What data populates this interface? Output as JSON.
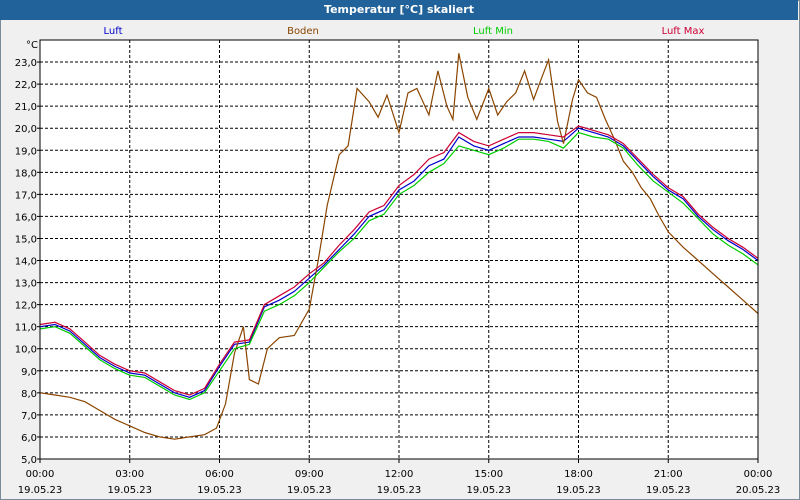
{
  "window": {
    "title": "Temperatur [°C] skaliert"
  },
  "chart_data": {
    "type": "line",
    "title": "Temperatur [°C] skaliert",
    "ylabel": "°C",
    "ylim": [
      5.0,
      24.0
    ],
    "xlim": [
      0,
      24
    ],
    "grid": true,
    "y_ticks": [
      "5,0",
      "6,0",
      "7,0",
      "8,0",
      "9,0",
      "10,0",
      "11,0",
      "12,0",
      "13,0",
      "14,0",
      "15,0",
      "16,0",
      "17,0",
      "18,0",
      "19,0",
      "20,0",
      "21,0",
      "22,0",
      "23,0"
    ],
    "x_ticks": [
      {
        "time": "00:00",
        "date": "19.05.23"
      },
      {
        "time": "03:00",
        "date": "19.05.23"
      },
      {
        "time": "06:00",
        "date": "19.05.23"
      },
      {
        "time": "09:00",
        "date": "19.05.23"
      },
      {
        "time": "12:00",
        "date": "19.05.23"
      },
      {
        "time": "15:00",
        "date": "19.05.23"
      },
      {
        "time": "18:00",
        "date": "19.05.23"
      },
      {
        "time": "21:00",
        "date": "19.05.23"
      },
      {
        "time": "00:00",
        "date": "20.05.23"
      }
    ],
    "series": [
      {
        "name": "Luft",
        "color": "#0000cc",
        "x": [
          0,
          0.5,
          1,
          1.5,
          2,
          2.5,
          3,
          3.5,
          4,
          4.5,
          5,
          5.5,
          6,
          6.5,
          7,
          7.5,
          8,
          8.5,
          9,
          9.5,
          10,
          10.5,
          11,
          11.5,
          12,
          12.5,
          13,
          13.5,
          14,
          14.5,
          15,
          15.5,
          16,
          16.5,
          17,
          17.5,
          18,
          18.5,
          19,
          19.5,
          20,
          20.5,
          21,
          21.5,
          22,
          22.5,
          23,
          23.5,
          24
        ],
        "values": [
          11.0,
          11.1,
          10.8,
          10.2,
          9.6,
          9.2,
          8.9,
          8.8,
          8.4,
          8.0,
          7.8,
          8.1,
          9.2,
          10.2,
          10.3,
          11.9,
          12.2,
          12.6,
          13.2,
          13.8,
          14.5,
          15.2,
          16.0,
          16.3,
          17.2,
          17.6,
          18.3,
          18.6,
          19.6,
          19.2,
          19.0,
          19.3,
          19.6,
          19.6,
          19.5,
          19.4,
          20.0,
          19.8,
          19.6,
          19.2,
          18.5,
          17.8,
          17.2,
          16.8,
          16.0,
          15.4,
          14.9,
          14.5,
          14.0
        ]
      },
      {
        "name": "Boden",
        "color": "#8b4500",
        "x": [
          0,
          0.5,
          1,
          1.5,
          2,
          2.5,
          3,
          3.5,
          4,
          4.5,
          5,
          5.5,
          5.9,
          6.2,
          6.5,
          6.8,
          7,
          7.3,
          7.6,
          8,
          8.5,
          9,
          9.3,
          9.6,
          10,
          10.3,
          10.6,
          11,
          11.3,
          11.6,
          12,
          12.3,
          12.6,
          13,
          13.3,
          13.6,
          13.8,
          14,
          14.3,
          14.6,
          15,
          15.3,
          15.6,
          15.9,
          16.2,
          16.5,
          16.8,
          17,
          17.3,
          17.5,
          17.8,
          18,
          18.3,
          18.6,
          18.9,
          19.2,
          19.5,
          19.8,
          20.1,
          20.4,
          20.7,
          21,
          21.5,
          22,
          22.5,
          23,
          23.5,
          24
        ],
        "values": [
          8.0,
          7.9,
          7.8,
          7.6,
          7.2,
          6.8,
          6.5,
          6.2,
          6.0,
          5.9,
          6.0,
          6.1,
          6.4,
          7.5,
          9.8,
          11.0,
          8.6,
          8.4,
          10.0,
          10.5,
          10.6,
          11.8,
          14.0,
          16.5,
          18.8,
          19.2,
          21.8,
          21.2,
          20.5,
          21.5,
          19.8,
          21.6,
          21.8,
          20.6,
          22.6,
          21.0,
          20.4,
          23.4,
          21.4,
          20.4,
          21.8,
          20.6,
          21.2,
          21.6,
          22.6,
          21.3,
          22.4,
          23.1,
          20.3,
          19.3,
          21.3,
          22.2,
          21.6,
          21.4,
          20.4,
          19.5,
          18.5,
          18.0,
          17.3,
          16.8,
          16.0,
          15.3,
          14.6,
          14.0,
          13.4,
          12.8,
          12.2,
          11.6
        ]
      },
      {
        "name": "Luft Min",
        "color": "#00cc00",
        "x": [
          0,
          0.5,
          1,
          1.5,
          2,
          2.5,
          3,
          3.5,
          4,
          4.5,
          5,
          5.5,
          6,
          6.5,
          7,
          7.5,
          8,
          8.5,
          9,
          9.5,
          10,
          10.5,
          11,
          11.5,
          12,
          12.5,
          13,
          13.5,
          14,
          14.5,
          15,
          15.5,
          16,
          16.5,
          17,
          17.5,
          18,
          18.5,
          19,
          19.5,
          20,
          20.5,
          21,
          21.5,
          22,
          22.5,
          23,
          23.5,
          24
        ],
        "values": [
          10.9,
          11.0,
          10.7,
          10.1,
          9.5,
          9.1,
          8.8,
          8.7,
          8.3,
          7.9,
          7.7,
          8.0,
          9.0,
          10.0,
          10.2,
          11.7,
          12.0,
          12.4,
          13.0,
          13.7,
          14.4,
          15.0,
          15.8,
          16.1,
          17.0,
          17.4,
          18.0,
          18.4,
          19.2,
          19.0,
          18.8,
          19.1,
          19.5,
          19.5,
          19.4,
          19.1,
          19.8,
          19.6,
          19.5,
          19.1,
          18.3,
          17.6,
          17.1,
          16.6,
          15.9,
          15.2,
          14.7,
          14.3,
          13.8
        ]
      },
      {
        "name": "Luft Max",
        "color": "#cc0033",
        "x": [
          0,
          0.5,
          1,
          1.5,
          2,
          2.5,
          3,
          3.5,
          4,
          4.5,
          5,
          5.5,
          6,
          6.5,
          7,
          7.5,
          8,
          8.5,
          9,
          9.5,
          10,
          10.5,
          11,
          11.5,
          12,
          12.5,
          13,
          13.5,
          14,
          14.5,
          15,
          15.5,
          16,
          16.5,
          17,
          17.5,
          18,
          18.5,
          19,
          19.5,
          20,
          20.5,
          21,
          21.5,
          22,
          22.5,
          23,
          23.5,
          24
        ],
        "values": [
          11.1,
          11.2,
          10.9,
          10.3,
          9.7,
          9.3,
          9.0,
          8.9,
          8.5,
          8.1,
          7.9,
          8.2,
          9.3,
          10.3,
          10.4,
          12.0,
          12.4,
          12.8,
          13.4,
          13.9,
          14.7,
          15.4,
          16.2,
          16.5,
          17.4,
          17.9,
          18.6,
          18.9,
          19.8,
          19.4,
          19.2,
          19.5,
          19.8,
          19.8,
          19.7,
          19.6,
          20.1,
          19.9,
          19.7,
          19.3,
          18.6,
          17.9,
          17.3,
          16.9,
          16.1,
          15.5,
          15.0,
          14.6,
          14.1
        ]
      }
    ]
  }
}
